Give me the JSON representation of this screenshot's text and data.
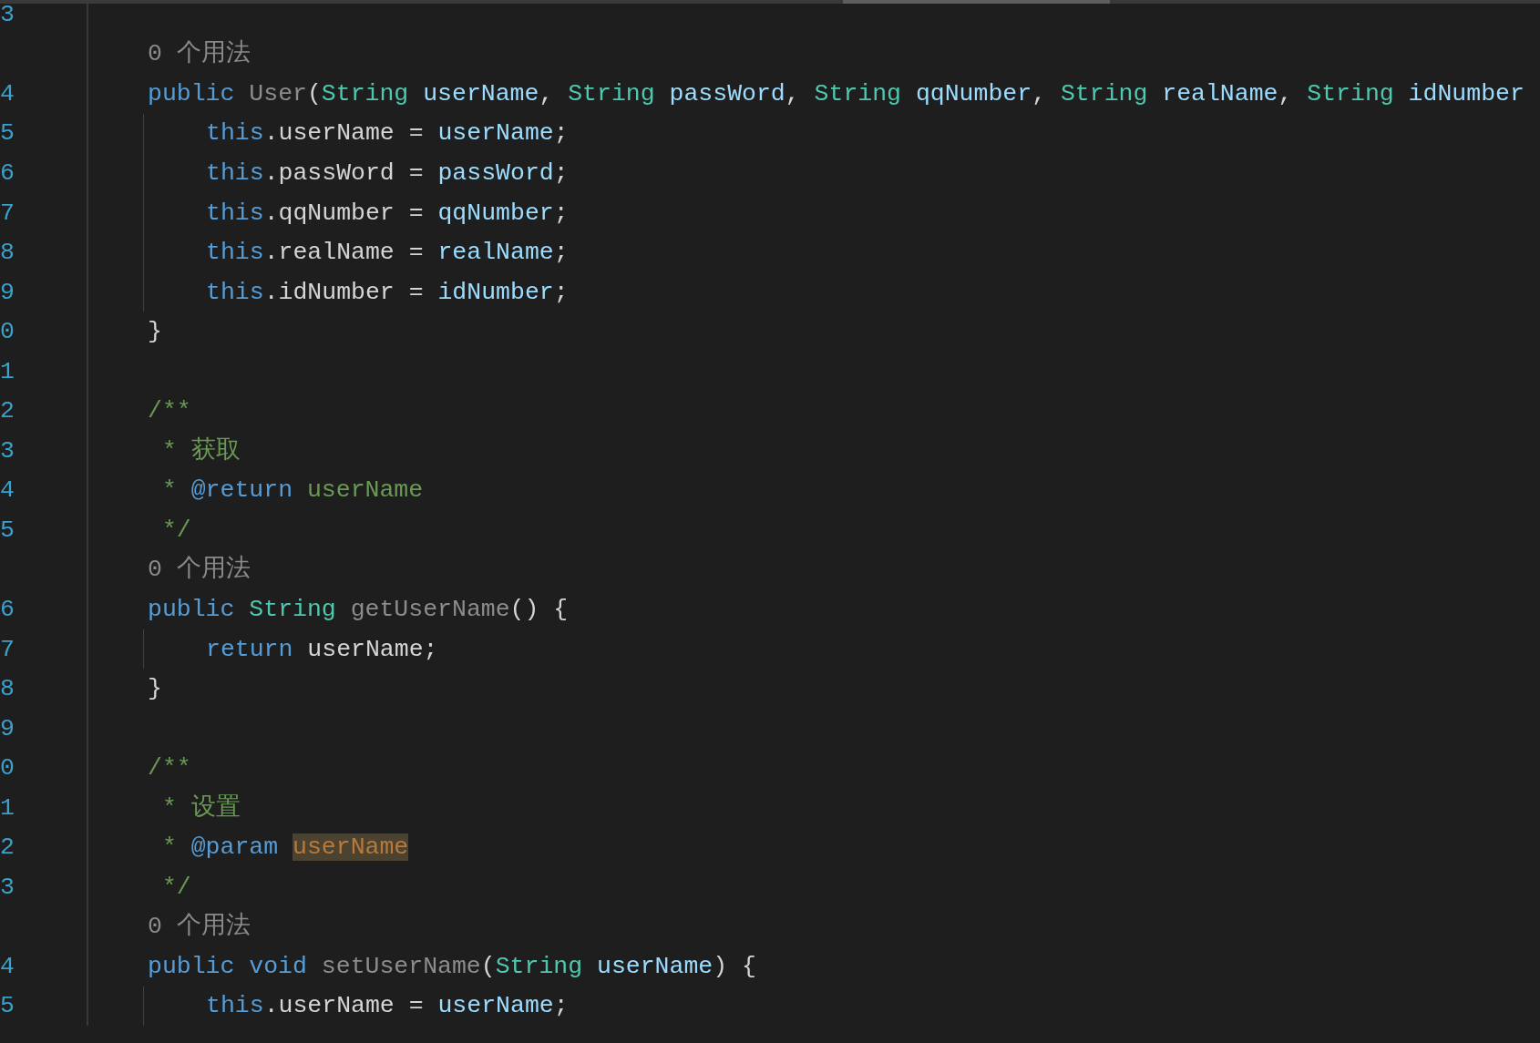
{
  "editor": {
    "lines": [
      {
        "number": "3",
        "indent_guide": false
      },
      {
        "indent_guide": false,
        "tokens": [
          {
            "kind": "hint",
            "text": "0 个用法"
          }
        ]
      },
      {
        "number": "4",
        "indent_guide": false,
        "tokens": [
          {
            "kind": "kw",
            "text": "public "
          },
          {
            "kind": "fn",
            "text": "User"
          },
          {
            "kind": "plain",
            "text": "("
          },
          {
            "kind": "type",
            "text": "String"
          },
          {
            "kind": "param",
            "text": " userName"
          },
          {
            "kind": "plain",
            "text": ", "
          },
          {
            "kind": "type",
            "text": "String"
          },
          {
            "kind": "param",
            "text": " passWord"
          },
          {
            "kind": "plain",
            "text": ", "
          },
          {
            "kind": "type",
            "text": "String"
          },
          {
            "kind": "param",
            "text": " qqNumber"
          },
          {
            "kind": "plain",
            "text": ", "
          },
          {
            "kind": "type",
            "text": "String"
          },
          {
            "kind": "param",
            "text": " realName"
          },
          {
            "kind": "plain",
            "text": ", "
          },
          {
            "kind": "type",
            "text": "String"
          },
          {
            "kind": "param",
            "text": " idNumber"
          }
        ]
      },
      {
        "number": "5",
        "indent_guide": true,
        "tokens": [
          {
            "kind": "kw",
            "text": "this"
          },
          {
            "kind": "plain",
            "text": ".userName = "
          },
          {
            "kind": "param",
            "text": "userName"
          },
          {
            "kind": "plain",
            "text": ";"
          }
        ]
      },
      {
        "number": "6",
        "indent_guide": true,
        "tokens": [
          {
            "kind": "kw",
            "text": "this"
          },
          {
            "kind": "plain",
            "text": ".passWord = "
          },
          {
            "kind": "param",
            "text": "passWord"
          },
          {
            "kind": "plain",
            "text": ";"
          }
        ]
      },
      {
        "number": "7",
        "indent_guide": true,
        "tokens": [
          {
            "kind": "kw",
            "text": "this"
          },
          {
            "kind": "plain",
            "text": ".qqNumber = "
          },
          {
            "kind": "param",
            "text": "qqNumber"
          },
          {
            "kind": "plain",
            "text": ";"
          }
        ]
      },
      {
        "number": "8",
        "indent_guide": true,
        "tokens": [
          {
            "kind": "kw",
            "text": "this"
          },
          {
            "kind": "plain",
            "text": ".realName = "
          },
          {
            "kind": "param",
            "text": "realName"
          },
          {
            "kind": "plain",
            "text": ";"
          }
        ]
      },
      {
        "number": "9",
        "indent_guide": true,
        "tokens": [
          {
            "kind": "kw",
            "text": "this"
          },
          {
            "kind": "plain",
            "text": ".idNumber = "
          },
          {
            "kind": "param",
            "text": "idNumber"
          },
          {
            "kind": "plain",
            "text": ";"
          }
        ]
      },
      {
        "number": "0",
        "indent_guide": false,
        "tokens": [
          {
            "kind": "plain",
            "text": "}"
          }
        ]
      },
      {
        "number": "1",
        "indent_guide": false
      },
      {
        "number": "2",
        "indent_guide": false,
        "tokens": [
          {
            "kind": "cm",
            "text": "/**"
          }
        ]
      },
      {
        "number": "3",
        "indent_guide": false,
        "tokens": [
          {
            "kind": "cm",
            "text": " * 获取"
          }
        ]
      },
      {
        "number": "4",
        "indent_guide": false,
        "tokens": [
          {
            "kind": "cm",
            "text": " * "
          },
          {
            "kind": "tag",
            "text": "@return"
          },
          {
            "kind": "cm",
            "text": " userName"
          }
        ]
      },
      {
        "number": "5",
        "indent_guide": false,
        "tokens": [
          {
            "kind": "cm",
            "text": " */"
          }
        ]
      },
      {
        "indent_guide": false,
        "tokens": [
          {
            "kind": "hint",
            "text": "0 个用法"
          }
        ]
      },
      {
        "number": "6",
        "indent_guide": false,
        "tokens": [
          {
            "kind": "kw",
            "text": "public "
          },
          {
            "kind": "type",
            "text": "String "
          },
          {
            "kind": "fn",
            "text": "getUserName"
          },
          {
            "kind": "plain",
            "text": "() {"
          }
        ]
      },
      {
        "number": "7",
        "indent_guide": true,
        "tokens": [
          {
            "kind": "kw",
            "text": "return"
          },
          {
            "kind": "plain",
            "text": " userName;"
          }
        ]
      },
      {
        "number": "8",
        "indent_guide": false,
        "tokens": [
          {
            "kind": "plain",
            "text": "}"
          }
        ]
      },
      {
        "number": "9",
        "indent_guide": false
      },
      {
        "number": "0",
        "indent_guide": false,
        "tokens": [
          {
            "kind": "cm",
            "text": "/**"
          }
        ]
      },
      {
        "number": "1",
        "indent_guide": false,
        "tokens": [
          {
            "kind": "cm",
            "text": " * 设置"
          }
        ]
      },
      {
        "number": "2",
        "indent_guide": false,
        "tokens": [
          {
            "kind": "cm",
            "text": " * "
          },
          {
            "kind": "tag",
            "text": "@param "
          },
          {
            "kind": "hl",
            "text": "userName"
          }
        ]
      },
      {
        "number": "3",
        "indent_guide": false,
        "tokens": [
          {
            "kind": "cm",
            "text": " */"
          }
        ]
      },
      {
        "indent_guide": false,
        "tokens": [
          {
            "kind": "hint",
            "text": "0 个用法"
          }
        ]
      },
      {
        "number": "4",
        "indent_guide": false,
        "tokens": [
          {
            "kind": "kw",
            "text": "public void "
          },
          {
            "kind": "fn",
            "text": "setUserName"
          },
          {
            "kind": "plain",
            "text": "("
          },
          {
            "kind": "type",
            "text": "String"
          },
          {
            "kind": "param",
            "text": " userName"
          },
          {
            "kind": "plain",
            "text": ") {"
          }
        ]
      },
      {
        "number": "5",
        "indent_guide": true,
        "tokens": [
          {
            "kind": "kw",
            "text": "this"
          },
          {
            "kind": "plain",
            "text": ".userName = "
          },
          {
            "kind": "param",
            "text": "userName"
          },
          {
            "kind": "plain",
            "text": ";"
          }
        ]
      }
    ]
  }
}
